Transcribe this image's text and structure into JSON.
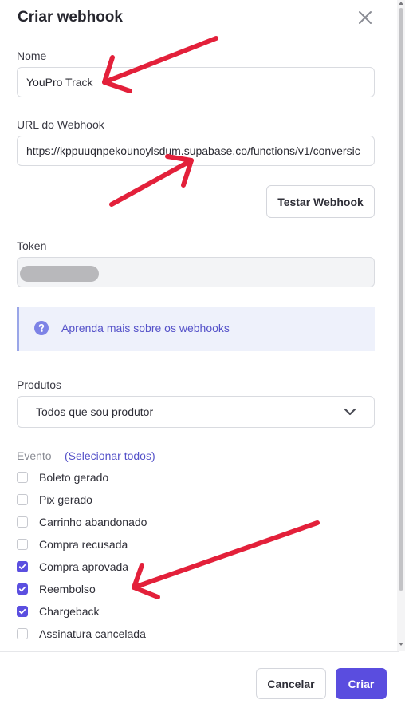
{
  "header": {
    "title": "Criar webhook"
  },
  "form": {
    "name_label": "Nome",
    "name_value": "YouPro Track",
    "url_label": "URL do Webhook",
    "url_value": "https://kppuuqnpekounoylsdum.supabase.co/functions/v1/conversic",
    "test_button": "Testar Webhook",
    "token_label": "Token",
    "info_text": "Aprenda mais sobre os webhooks",
    "products_label": "Produtos",
    "products_value": "Todos que sou produtor",
    "events_label": "Evento",
    "select_all": "(Selecionar todos)",
    "events": [
      {
        "label": "Boleto gerado",
        "checked": false
      },
      {
        "label": "Pix gerado",
        "checked": false
      },
      {
        "label": "Carrinho abandonado",
        "checked": false
      },
      {
        "label": "Compra recusada",
        "checked": false
      },
      {
        "label": "Compra aprovada",
        "checked": true
      },
      {
        "label": "Reembolso",
        "checked": true
      },
      {
        "label": "Chargeback",
        "checked": true
      },
      {
        "label": "Assinatura cancelada",
        "checked": false
      }
    ]
  },
  "footer": {
    "cancel": "Cancelar",
    "submit": "Criar"
  },
  "colors": {
    "accent": "#5a4ddf",
    "annotation": "#e3203a"
  }
}
